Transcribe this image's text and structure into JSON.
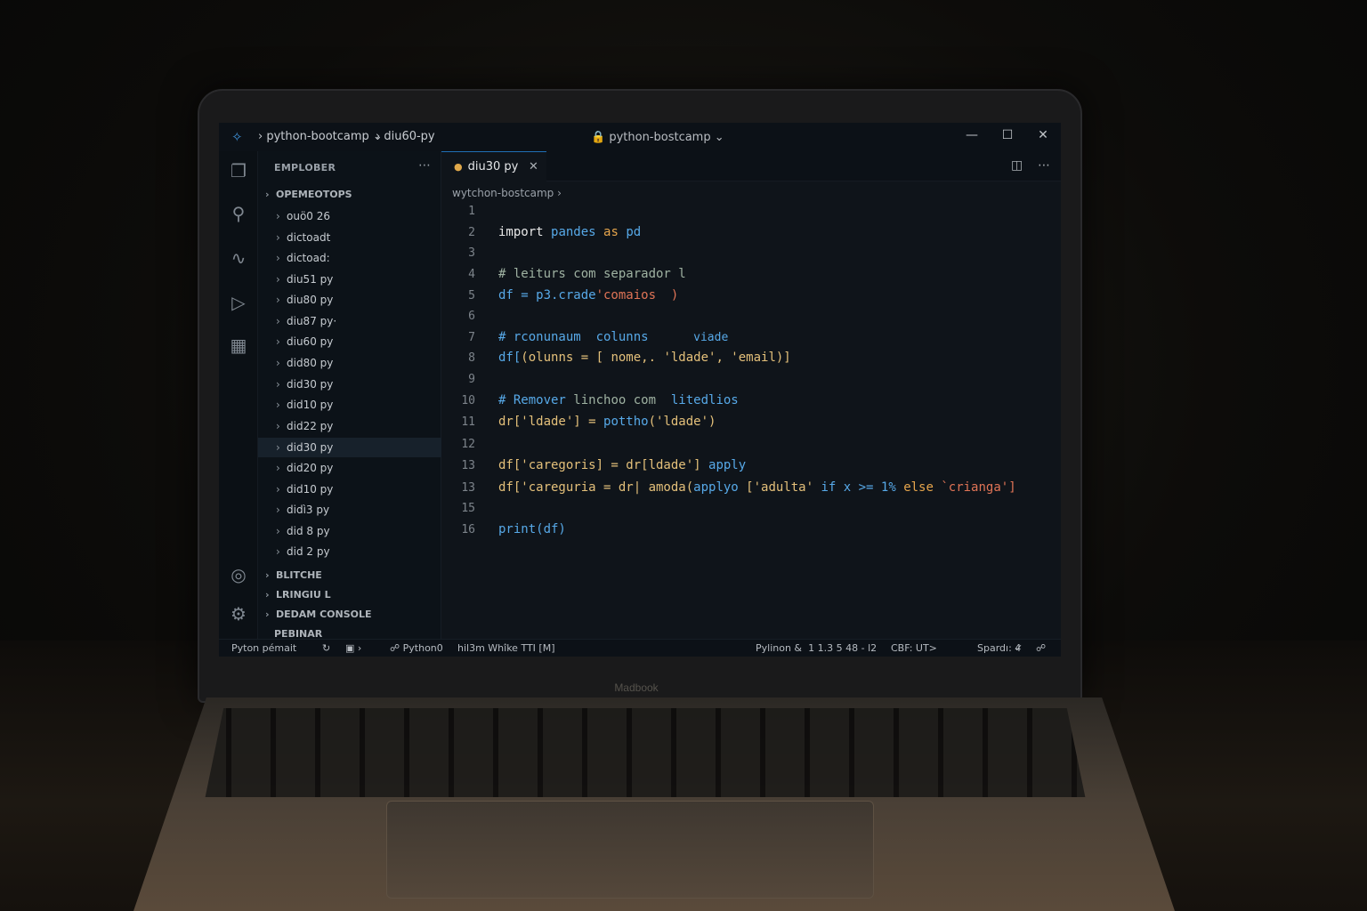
{
  "device": {
    "brand": "Madbook"
  },
  "titlebar": {
    "crumb_workspace": "python-bootcamp",
    "crumb_file": "diu60-py",
    "center_title": "python-bostcamp",
    "minimize_icon": "minimize-icon",
    "maximize_icon": "maximize-icon",
    "close_icon": "close-icon"
  },
  "sidebar": {
    "title": "EMPLOBER",
    "section_open": "OPEMEOTOPS",
    "items": [
      "ouö0 26",
      "dictoadt",
      "dictoad:",
      "diu51 py",
      "diu80 py",
      "diu87 py·",
      "diu60 py",
      "did80 py",
      "did30 py",
      "did10 py",
      "did22 py",
      "did30 py",
      "did20 py",
      "did10 py",
      "didì3 py",
      "did 8 py",
      "did 2 py"
    ],
    "active_index": 11,
    "sections_bottom": [
      "BLITCHE",
      "LRINGIU L",
      "DEDAM CONSOLE",
      "PEBINAR"
    ]
  },
  "tab": {
    "label": "diu30 py"
  },
  "breadcrumb": "wytchon-bostcamp",
  "editor": {
    "line_numbers": [
      "1",
      "2",
      "3",
      "4",
      "5",
      "6",
      "7",
      "8",
      "9",
      "10",
      "11",
      "12",
      "13",
      "13",
      "15",
      "16"
    ]
  },
  "code": {
    "l2_import": "import",
    "l2_module": "pandes",
    "l2_as": "as",
    "l2_alias": "pd",
    "l4": "# leiturs com separador l",
    "l5_a": "df = p3.crade",
    "l5_b": "'comaios  )",
    "l7_a": "# rconunaum  colunns",
    "l7_b": "viade",
    "l8_a": "df[",
    "l8_b": "(olunns = [ nome,. 'ldade', 'email)]",
    "l10_a": "# Remover",
    "l10_b": "linchoo com",
    "l10_c": "litedlios",
    "l11_a": "dr['ldade'] = ",
    "l11_b": "pottho",
    "l11_c": "('ldade')",
    "l13a_a": "df['caregoris] = dr[ldade'] ",
    "l13a_b": "apply",
    "l13b_a": "df['careguria = dr| amoda(",
    "l13b_b": "applyo",
    "l13b_c": "['adulta'",
    "l13b_d": " if x >= 1% ",
    "l13b_e": "else",
    "l13b_f": " `crianga']",
    "l16": "print(df)"
  },
  "statusbar": {
    "left": "Pyton pémait",
    "branch": "Python0",
    "mode": "hil3m  Whîke  TTI [M]",
    "python": "Pylinon &  1 1.3 5 48 - l2",
    "encoding": "CBF: UT>",
    "spaces": "Spardı: 4"
  }
}
